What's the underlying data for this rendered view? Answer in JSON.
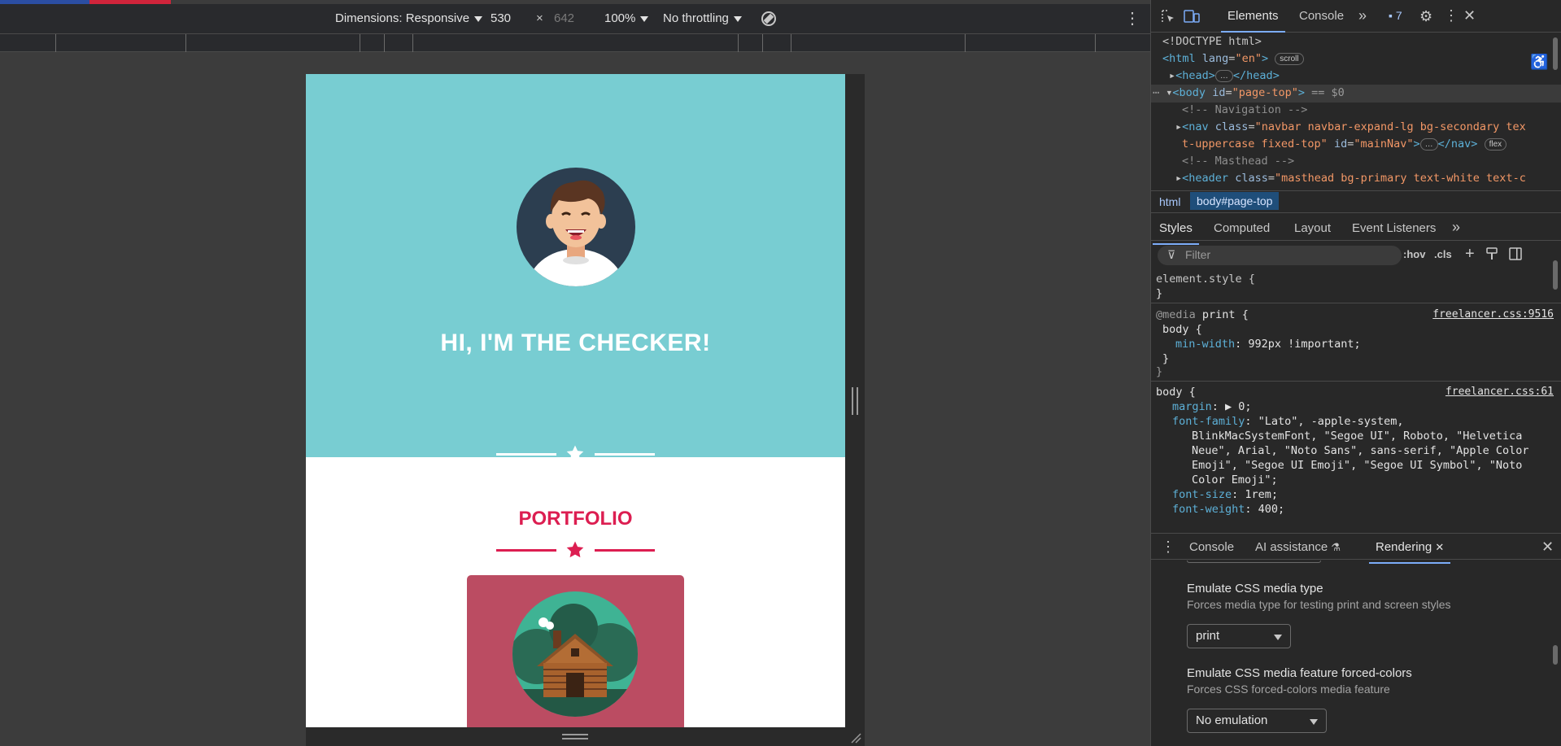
{
  "device_toolbar": {
    "dimensions_label": "Dimensions: Responsive",
    "width_value": "530",
    "times": "×",
    "height_value": "642",
    "zoom": "100%",
    "throttling": "No throttling"
  },
  "page": {
    "hero_title": "HI, I'M THE CHECKER!",
    "portfolio_title": "PORTFOLIO"
  },
  "devtools": {
    "tabs": [
      "Elements",
      "Console"
    ],
    "issues_count": "7",
    "dom": {
      "doctype": "<!DOCTYPE html>",
      "html_open": "<html",
      "html_lang_attr": "lang",
      "html_lang_val": "\"en\"",
      "scroll_pill": "scroll",
      "head_open": "<head>",
      "head_close": "</head>",
      "ellipsis": "…",
      "body_open": "<body",
      "body_id_attr": "id",
      "body_id_val": "\"page-top\"",
      "body_gt": ">",
      "body_eq": "== $0",
      "comment_nav": "<!-- Navigation -->",
      "nav_open": "<nav",
      "nav_class_attr": "class",
      "nav_class_val_1": "\"navbar navbar-expand-lg bg-secondary tex",
      "nav_class_val_2": "t-uppercase fixed-top\"",
      "nav_id_attr": "id",
      "nav_id_val": "\"mainNav\"",
      "nav_gt": ">",
      "nav_close": "</nav>",
      "flex_pill": "flex",
      "comment_masthead": "<!-- Masthead -->",
      "header_open": "<header",
      "header_class_attr": "class",
      "header_class_val": "\"masthead bg-primary text-white text-c"
    },
    "breadcrumb": [
      "html",
      "body#page-top"
    ],
    "styles_tabs": [
      "Styles",
      "Computed",
      "Layout",
      "Event Listeners"
    ],
    "filter_placeholder": "Filter",
    "hov": ":hov",
    "cls": ".cls",
    "styles": {
      "element_style": "element.style {",
      "close_brace": "}",
      "media_kw": "@media",
      "media_type": "print {",
      "media_src": "freelancer.css:9516",
      "body_sel": "body {",
      "min_width_prop": "min-width",
      "min_width_val": ": 992px !important;",
      "body_src": "freelancer.css:61",
      "margin_prop": "margin",
      "margin_val": ": ▶ 0;",
      "font_family_prop": "font-family",
      "font_family_val_1": ": \"Lato\", -apple-system,",
      "font_family_val_2": "BlinkMacSystemFont, \"Segoe UI\", Roboto, \"Helvetica",
      "font_family_val_3": "Neue\", Arial, \"Noto Sans\", sans-serif, \"Apple Color",
      "font_family_val_4": "Emoji\", \"Segoe UI Emoji\", \"Segoe UI Symbol\", \"Noto",
      "font_family_val_5": "Color Emoji\";",
      "font_size_prop": "font-size",
      "font_size_val": ": 1rem;",
      "font_weight_prop": "font-weight",
      "font_weight_val": ": 400;"
    },
    "drawer_tabs": [
      "Console",
      "AI assistance",
      "Rendering"
    ],
    "rendering": {
      "media_type_title": "Emulate CSS media type",
      "media_type_desc": "Forces media type for testing print and screen styles",
      "media_type_value": "print",
      "forced_colors_title": "Emulate CSS media feature forced-colors",
      "forced_colors_desc": "Forces CSS forced-colors media feature",
      "forced_colors_value": "No emulation"
    }
  },
  "colors": {
    "masthead_bg": "#78cdd2",
    "portfolio_accent": "#dc1e51",
    "card_bg": "#bb4c62",
    "devtools_accent": "#7cacf8"
  }
}
